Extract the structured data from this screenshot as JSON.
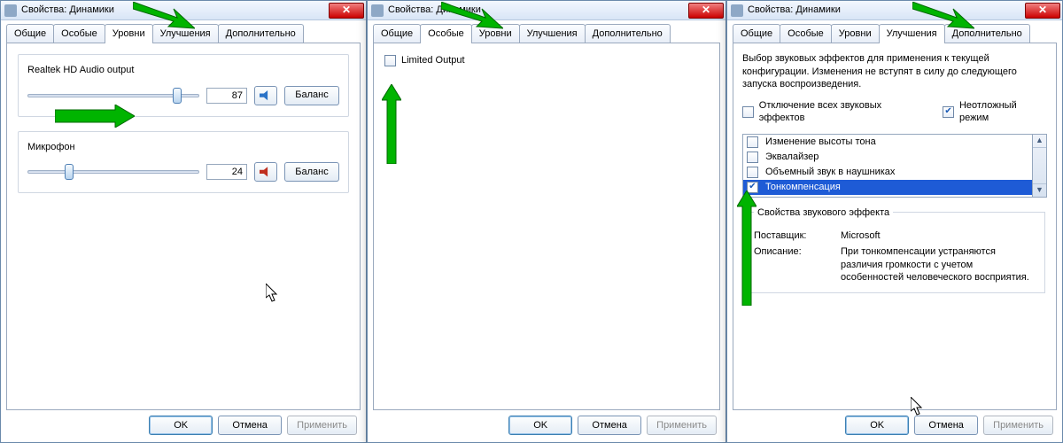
{
  "common": {
    "title": "Свойства: Динамики",
    "ok": "OK",
    "cancel": "Отмена",
    "apply": "Применить"
  },
  "tabs": {
    "general": "Общие",
    "custom": "Особые",
    "levels": "Уровни",
    "enhance": "Улучшения",
    "advanced": "Дополнительно"
  },
  "p1": {
    "dev1": "Realtek HD Audio output",
    "val1": "87",
    "balance": "Баланс",
    "dev2": "Микрофон",
    "val2": "24"
  },
  "p2": {
    "limited": "Limited Output"
  },
  "p3": {
    "intro": "Выбор звуковых эффектов для применения к текущей конфигурации. Изменения не вступят в силу до следующего запуска воспроизведения.",
    "disableAll": "Отключение всех звуковых эффектов",
    "immediate": "Неотложный режим",
    "items": {
      "pitch": "Изменение высоты тона",
      "eq": "Эквалайзер",
      "hp": "Объемный звук в наушниках",
      "loud": "Тонкомпенсация"
    },
    "fx": {
      "legend": "Свойства звукового эффекта",
      "providerLbl": "Поставщик:",
      "provider": "Microsoft",
      "descLbl": "Описание:",
      "desc": "При тонкомпенсации устраняются различия громкости с учетом особенностей человеческого восприятия."
    }
  }
}
